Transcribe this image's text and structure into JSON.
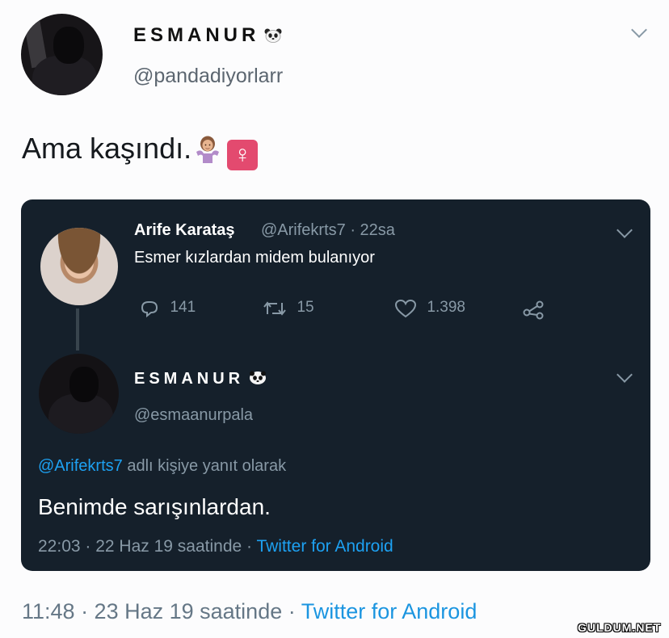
{
  "outer_tweet": {
    "display_name": "ESMANUR",
    "username": "@pandadiyorlarr",
    "text": "Ama kaşındı.",
    "timestamp": "11:48 · 23 Haz 19 saatinde · ",
    "source": "Twitter for Android"
  },
  "quoted_tweet": {
    "name": "Arife Karataş",
    "meta": "@Arifekrts7 · 22sa",
    "text": "Esmer kızlardan midem bulanıyor",
    "replies": "141",
    "retweets": "15",
    "likes": "1.398"
  },
  "reply_tweet": {
    "display_name": "ESMANUR",
    "username": "@esmaanurpala",
    "reply_mention": "@Arifekrts7",
    "reply_suffix": " adlı kişiye yanıt olarak",
    "text": "Benimde sarışınlardan.",
    "timestamp": "22:03 · 22 Haz 19 saatinde · ",
    "source": "Twitter for Android"
  },
  "watermark": "GULDUM.NET",
  "colors": {
    "card_bg": "#15202b",
    "link": "#1da1f2",
    "muted": "#8899a6"
  }
}
